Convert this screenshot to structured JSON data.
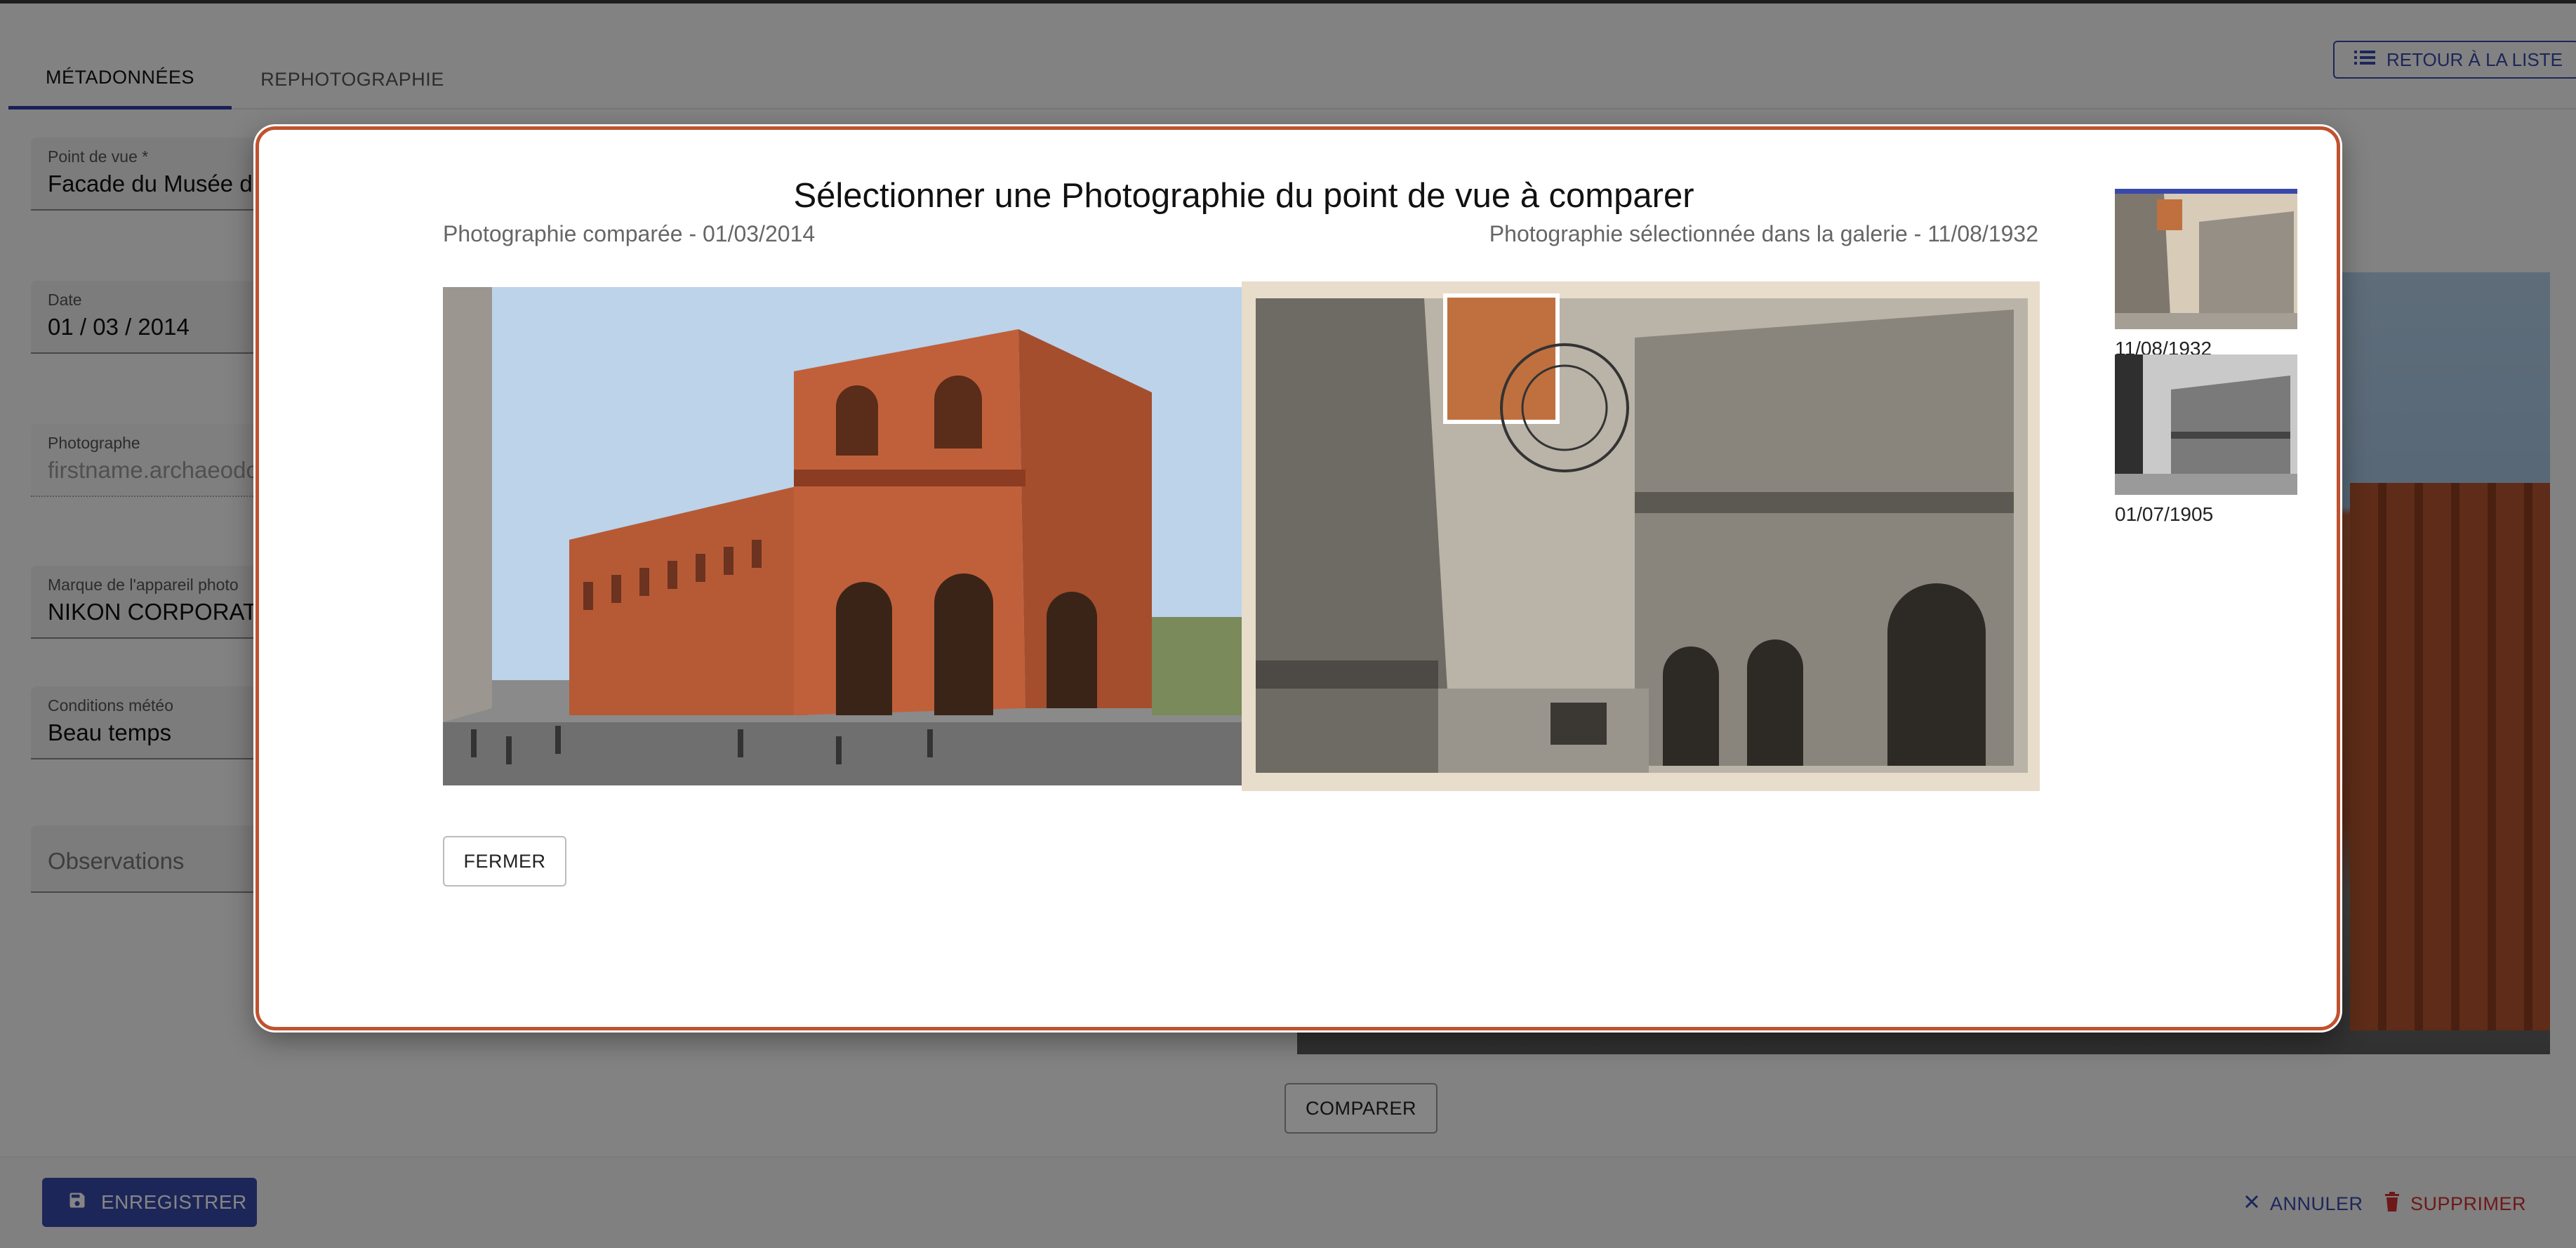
{
  "tabs": [
    {
      "label": "MÉTADONNÉES",
      "active": true
    },
    {
      "label": "REPHOTOGRAPHIE",
      "active": false
    }
  ],
  "back_to_list": {
    "label": "RETOUR À LA LISTE",
    "icon": "list-icon"
  },
  "fields": {
    "viewpoint": {
      "label": "Point de vue *",
      "value": "Facade du Musée des"
    },
    "date": {
      "label": "Date",
      "value": "01 / 03 / 2014"
    },
    "photographer": {
      "label": "Photographe",
      "value": "firstname.archaeodo"
    },
    "camera_brand": {
      "label": "Marque de l'appareil photo",
      "value": "NIKON CORPORATION"
    },
    "weather": {
      "label": "Conditions météo",
      "value": "Beau temps"
    },
    "observations": {
      "placeholder": "Observations"
    }
  },
  "compare_button": "COMPARER",
  "footer": {
    "save": {
      "label": "ENREGISTRER",
      "icon": "save-icon"
    },
    "cancel": {
      "label": "ANNULER",
      "icon": "close-icon"
    },
    "delete": {
      "label": "SUPPRIMER",
      "icon": "trash-icon"
    }
  },
  "modal": {
    "title": "Sélectionner une Photographie du point de vue à comparer",
    "left_caption": "Photographie comparée - 01/03/2014",
    "right_caption": "Photographie sélectionnée dans la galerie - 11/08/1932",
    "close_label": "FERMER",
    "gallery": [
      {
        "date": "11/08/1932",
        "selected": true
      },
      {
        "date": "01/07/1905",
        "selected": false
      }
    ]
  },
  "colors": {
    "primary": "#3949ab",
    "danger": "#d32f2f",
    "modal_border": "#c0522f"
  }
}
